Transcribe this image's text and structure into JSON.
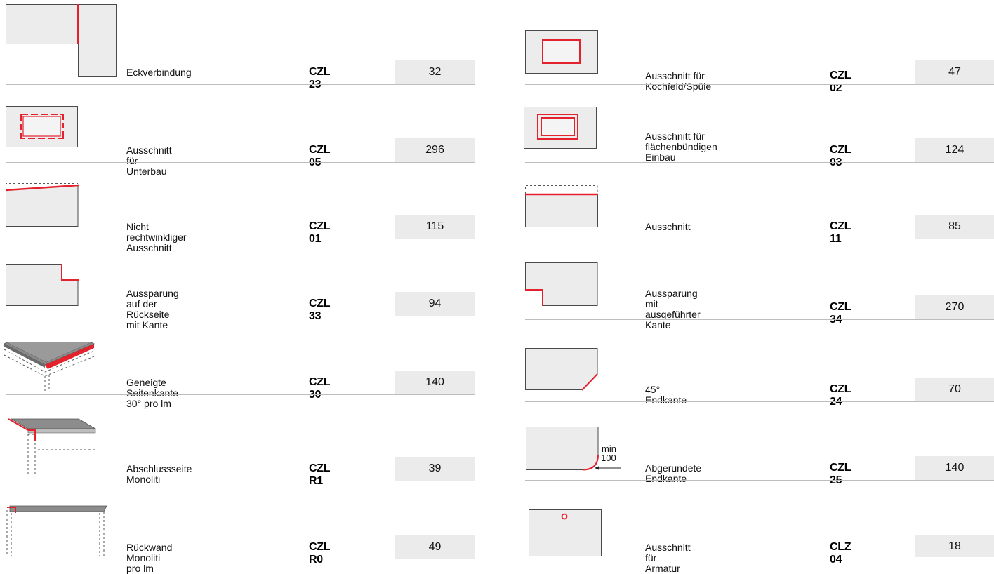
{
  "left": [
    {
      "description": "Eckverbindung",
      "code": "CZL 23",
      "price": "32"
    },
    {
      "description": "Ausschnitt für Unterbau",
      "code": "CZL 05",
      "price": "296"
    },
    {
      "description": "Nicht rechtwinkliger Ausschnitt",
      "code": "CZL 01",
      "price": "115"
    },
    {
      "description": "Aussparung auf der Rückseite\nmit Kante",
      "code": "CZL 33",
      "price": "94"
    },
    {
      "description": "Geneigte Seitenkante 30° pro lm",
      "code": "CZL 30",
      "price": "140"
    },
    {
      "description": "Abschlussseite Monoliti",
      "code": "CZL R1",
      "price": "39"
    },
    {
      "description": "Rückwand Monoliti pro lm",
      "code": "CZL R0",
      "price": "49"
    }
  ],
  "right": [
    {
      "description": "Ausschnitt für Kochfeld/Spüle",
      "code": "CZL 02",
      "price": "47"
    },
    {
      "description": "Ausschnitt für flächenbündigen\nEinbau",
      "code": "CZL 03",
      "price": "124"
    },
    {
      "description": "Ausschnitt",
      "code": "CZL 11",
      "price": "85"
    },
    {
      "description": "Aussparung mit ausgeführter\nKante",
      "code": "CZL 34",
      "price": "270"
    },
    {
      "description": "45° Endkante",
      "code": "CZL 24",
      "price": "70"
    },
    {
      "description": "Abgerundete Endkante",
      "code": "CZL 25",
      "price": "140"
    },
    {
      "description": "Ausschnitt für Armatur",
      "code": "CLZ 04",
      "price": "18"
    }
  ],
  "annotations": {
    "min_label": "min",
    "min_value": "100"
  },
  "colors": {
    "accent_red": "#e4222d",
    "price_bg": "#ebebeb",
    "panel_fill": "#ececec"
  }
}
